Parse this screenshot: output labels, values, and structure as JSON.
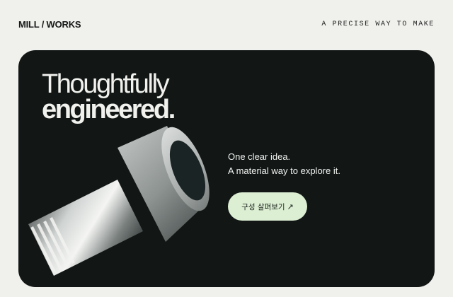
{
  "header": {
    "brand": "MILL / WORKS",
    "tagline": "A PRECISE WAY TO MAKE"
  },
  "hero": {
    "headline_line1": "Thoughtfully",
    "headline_line2": "engineered.",
    "body_line1": "One clear idea.",
    "body_line2": "A material way to explore it.",
    "cta_label": "구성 살펴보기",
    "cta_icon": "arrow-up-right-icon",
    "cta_arrow": "↗"
  },
  "colors": {
    "page_background": "#f0f0ec",
    "hero_background": "#121716",
    "cta_background": "#dcefd3",
    "text_light": "#f1f2ee"
  }
}
